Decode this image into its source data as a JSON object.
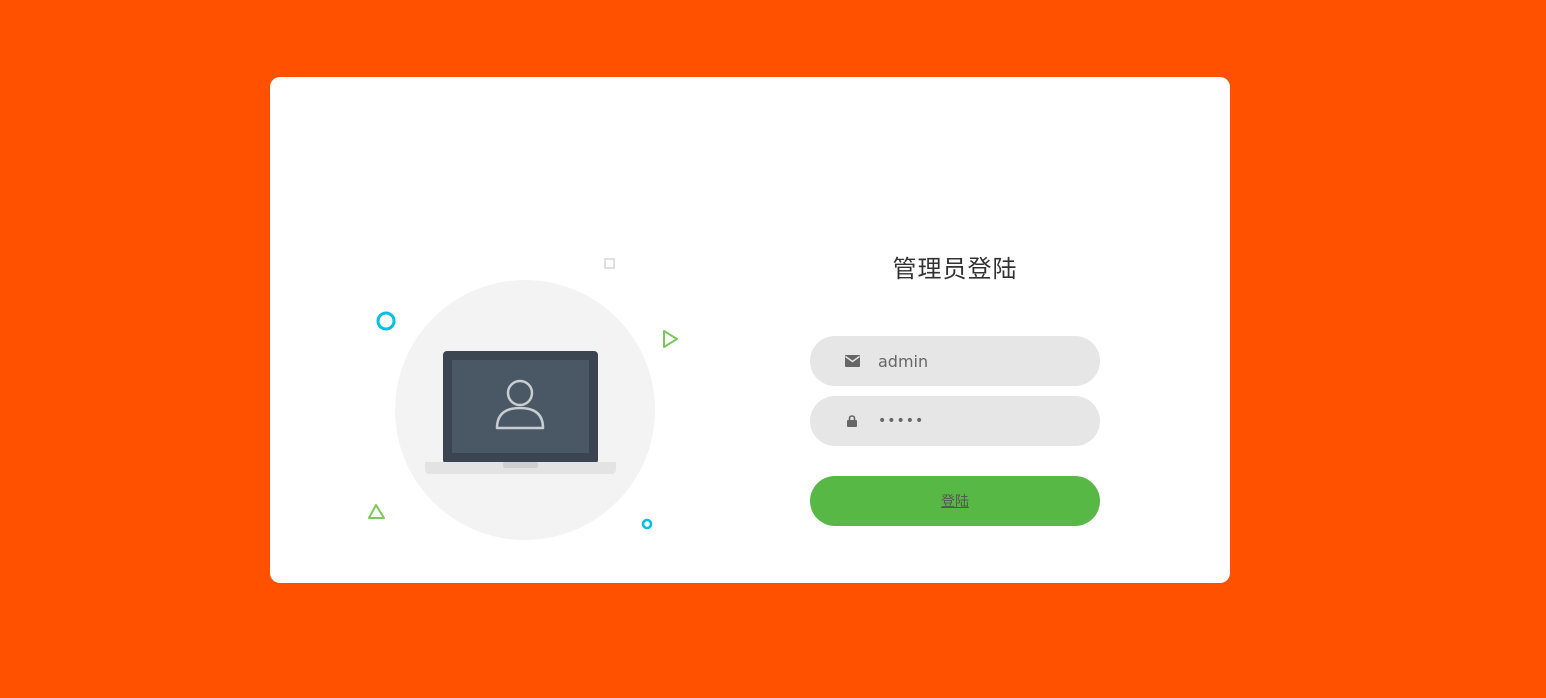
{
  "login": {
    "title": "管理员登陆",
    "username": {
      "value": "admin",
      "icon": "envelope-icon"
    },
    "password": {
      "value": "admin",
      "icon": "lock-icon"
    },
    "submit_label": "登陆"
  },
  "colors": {
    "background": "#FF5100",
    "card": "#FFFFFF",
    "input_bg": "#E6E6E6",
    "button": "#57B846",
    "accent_cyan": "#00BFE4",
    "accent_green": "#7BC95A"
  }
}
